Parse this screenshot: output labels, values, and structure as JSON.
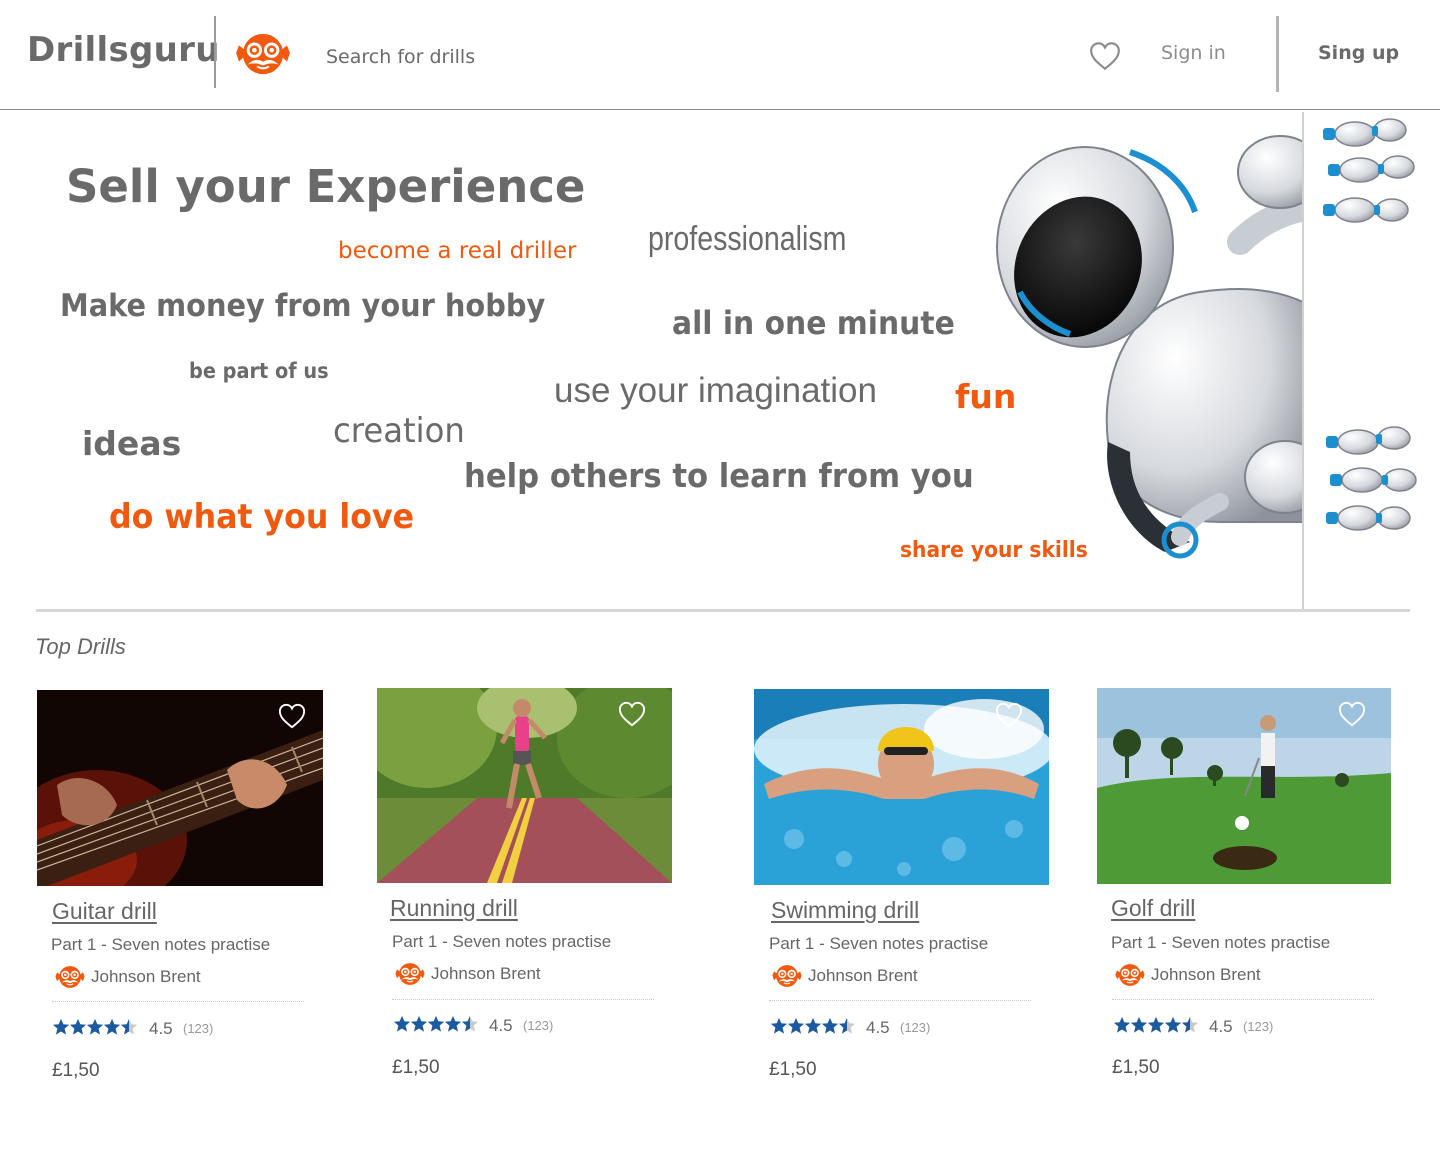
{
  "colors": {
    "brand_orange": "#f15a0e",
    "text_gray": "#6a6a6a",
    "star_blue": "#1b5aa0"
  },
  "header": {
    "brand": "Drillsguru",
    "logo_icon": "mascot-logo-icon",
    "search": {
      "placeholder": "Search for drills",
      "value": ""
    },
    "favorites_icon": "heart-icon",
    "signin": "Sign in",
    "signup": "Sing up"
  },
  "hero": {
    "title": "Sell your Experience",
    "phrases": {
      "become": "become a real driller",
      "professionalism": "professionalism",
      "money": "Make money from your hobby",
      "minute": "all in one minute",
      "part": "be part of us",
      "imagination": "use your imagination",
      "fun": "fun",
      "ideas": "ideas",
      "creation": "creation",
      "help": "help others to learn from you",
      "love": "do what you love",
      "share": "share your skills"
    },
    "illustration": "robot-peeking-illustration"
  },
  "top_drills": {
    "title": "Top Drills",
    "cards": [
      {
        "title": "Guitar drill",
        "subtitle": "Part 1 - Seven notes practise",
        "author": "Johnson Brent",
        "rating": "4.5",
        "rating_value": 4.5,
        "count": "(123)",
        "price": "£1,50",
        "image": "guitar-photo"
      },
      {
        "title": "Running drill",
        "subtitle": "Part 1 - Seven notes practise",
        "author": "Johnson Brent",
        "rating": "4.5",
        "rating_value": 4.5,
        "count": "(123)",
        "price": "£1,50",
        "image": "running-photo"
      },
      {
        "title": "Swimming drill",
        "subtitle": "Part 1 - Seven notes practise",
        "author": "Johnson Brent",
        "rating": "4.5",
        "rating_value": 4.5,
        "count": "(123)",
        "price": "£1,50",
        "image": "swimming-photo"
      },
      {
        "title": "Golf drill",
        "subtitle": "Part 1 - Seven notes practise",
        "author": "Johnson Brent",
        "rating": "4.5",
        "rating_value": 4.5,
        "count": "(123)",
        "price": "£1,50",
        "image": "golf-photo"
      }
    ]
  }
}
